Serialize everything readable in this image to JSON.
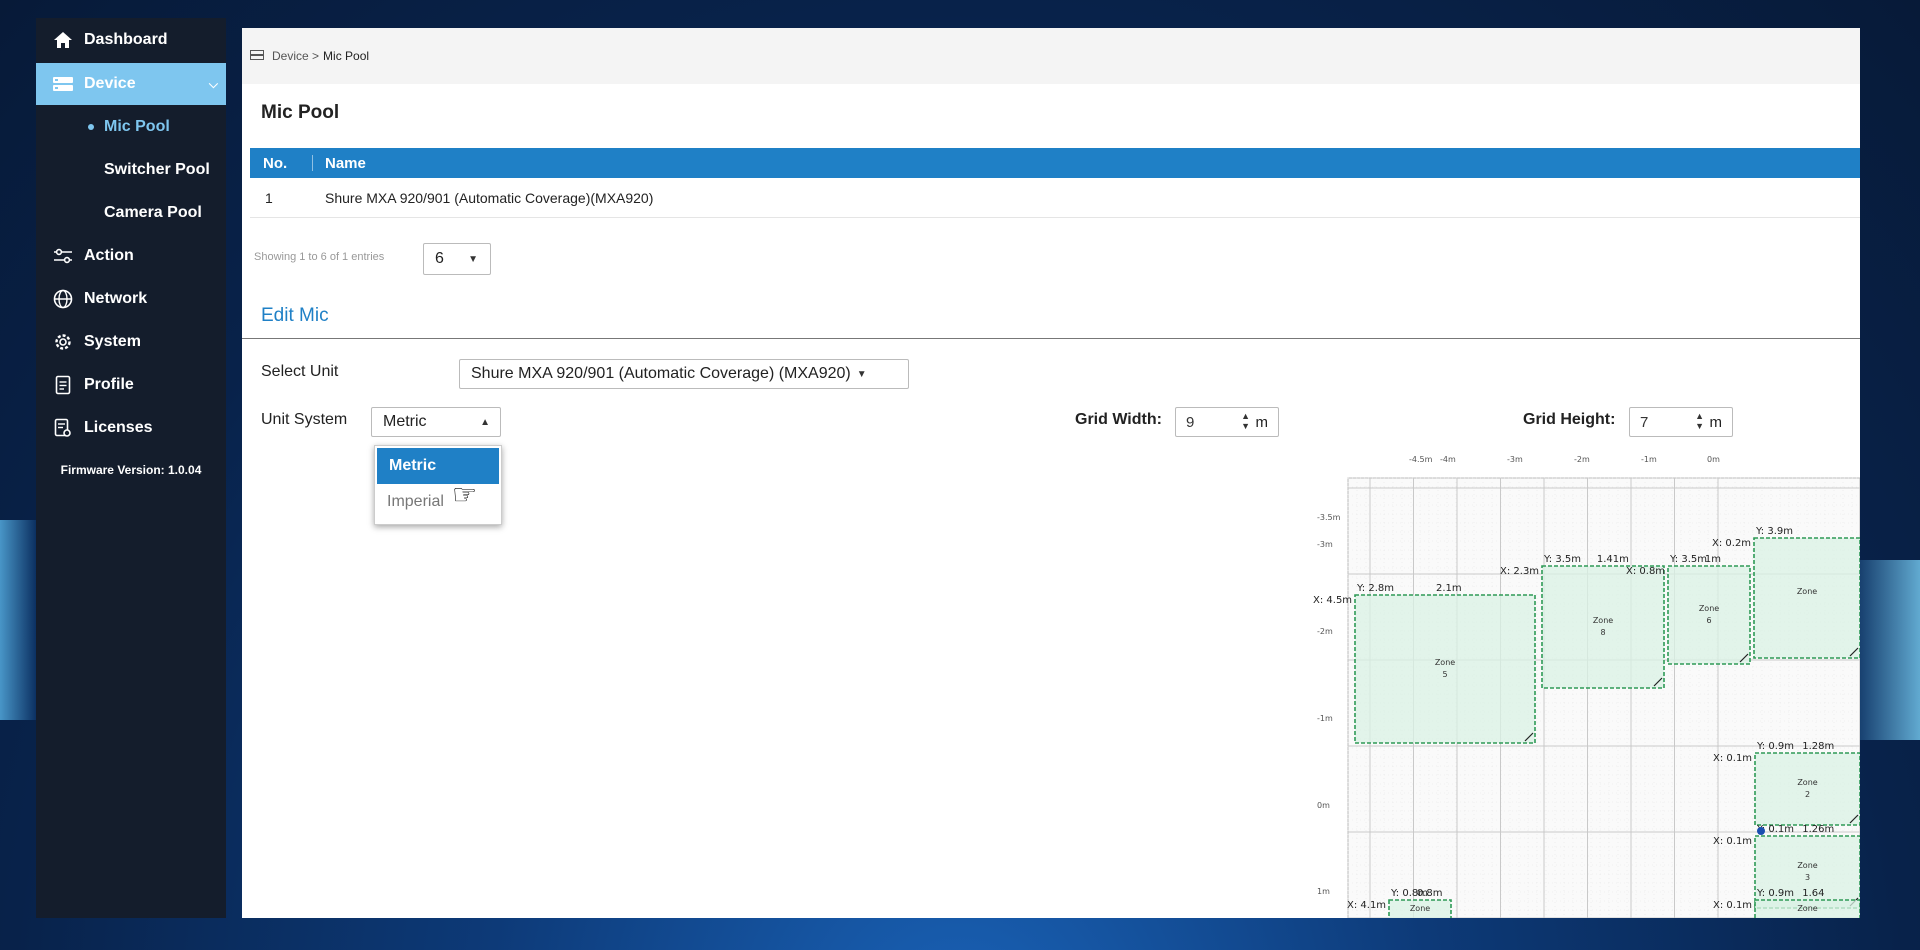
{
  "sidebar": {
    "items": [
      {
        "label": "Dashboard",
        "icon": "home-icon"
      },
      {
        "label": "Device",
        "icon": "server-icon",
        "active": true
      },
      {
        "label": "Action",
        "icon": "sliders-icon"
      },
      {
        "label": "Network",
        "icon": "globe-icon"
      },
      {
        "label": "System",
        "icon": "gear-icon"
      },
      {
        "label": "Profile",
        "icon": "document-icon"
      },
      {
        "label": "Licenses",
        "icon": "license-icon"
      }
    ],
    "sub_items": [
      {
        "label": "Mic Pool",
        "current": true
      },
      {
        "label": "Switcher Pool"
      },
      {
        "label": "Camera Pool"
      }
    ],
    "firmware": "Firmware Version: 1.0.04"
  },
  "breadcrumb": {
    "parent": "Device >",
    "current": "Mic Pool"
  },
  "page_title": "Mic Pool",
  "table": {
    "columns": [
      "No.",
      "Name"
    ],
    "rows": [
      [
        "1",
        "Shure MXA 920/901 (Automatic Coverage)(MXA920)"
      ]
    ],
    "entries_text": "Showing 1 to 6 of 1 entries",
    "page_size": "6"
  },
  "edit_mic": {
    "title": "Edit Mic",
    "select_unit_label": "Select Unit",
    "select_unit_value": "Shure MXA 920/901 (Automatic Coverage) (MXA920)",
    "unit_system_label": "Unit System",
    "unit_system_value": "Metric",
    "unit_system_options": [
      "Metric",
      "Imperial"
    ],
    "grid_width_label": "Grid Width:",
    "grid_width_value": "9",
    "grid_width_unit": "m",
    "grid_height_label": "Grid Height:",
    "grid_height_value": "7",
    "grid_height_unit": "m"
  },
  "coverage_grid": {
    "top_ticks": [
      "-4.5m",
      "-4m",
      "-3m",
      "-2m",
      "-1m",
      "0m"
    ],
    "left_ticks": [
      "-3.5m",
      "-3m",
      "-2m",
      "-1m",
      "0m",
      "1m"
    ],
    "zones": [
      {
        "name": "Zone",
        "number": "5",
        "x_label": "X: 4.5m",
        "y_label": "Y: 2.8m",
        "size_label": "2.1m"
      },
      {
        "name": "Zone",
        "number": "8",
        "x_label": "X: 2.3m",
        "y_label": "Y: 3.5m",
        "size_label": "1.41m"
      },
      {
        "name": "Zone",
        "number": "6",
        "x_label": "X: 0.8m",
        "y_label": "Y: 3.5m",
        "size_label": "1m"
      },
      {
        "name": "Zone",
        "number": "",
        "x_label": "X: 0.2m",
        "y_label": "Y: 3.9m",
        "size_label": ""
      },
      {
        "name": "Zone",
        "number": "2",
        "x_label": "X: 0.1m",
        "y_label": "Y: 0.9m",
        "size_label": "1.28m"
      },
      {
        "name": "Zone",
        "number": "3",
        "x_label": "X: 0.1m",
        "y_label": "Y: 0.1m",
        "size_label": "1.26m"
      },
      {
        "name": "Zone",
        "number": "",
        "x_label": "X: 4.1m",
        "y_label": "Y: 0.8m",
        "size_label": "0.8m"
      },
      {
        "name": "Zone",
        "number": "",
        "x_label": "X: 0.1m",
        "y_label": "Y: 0.9m",
        "size_label": "1.64"
      }
    ]
  },
  "colors": {
    "accent": "#1f80c6",
    "sidebar_bg": "#141d2c",
    "sidebar_active": "#7ec6ef",
    "zone_fill": "#d9f2e4",
    "zone_stroke": "#2e9a56"
  }
}
